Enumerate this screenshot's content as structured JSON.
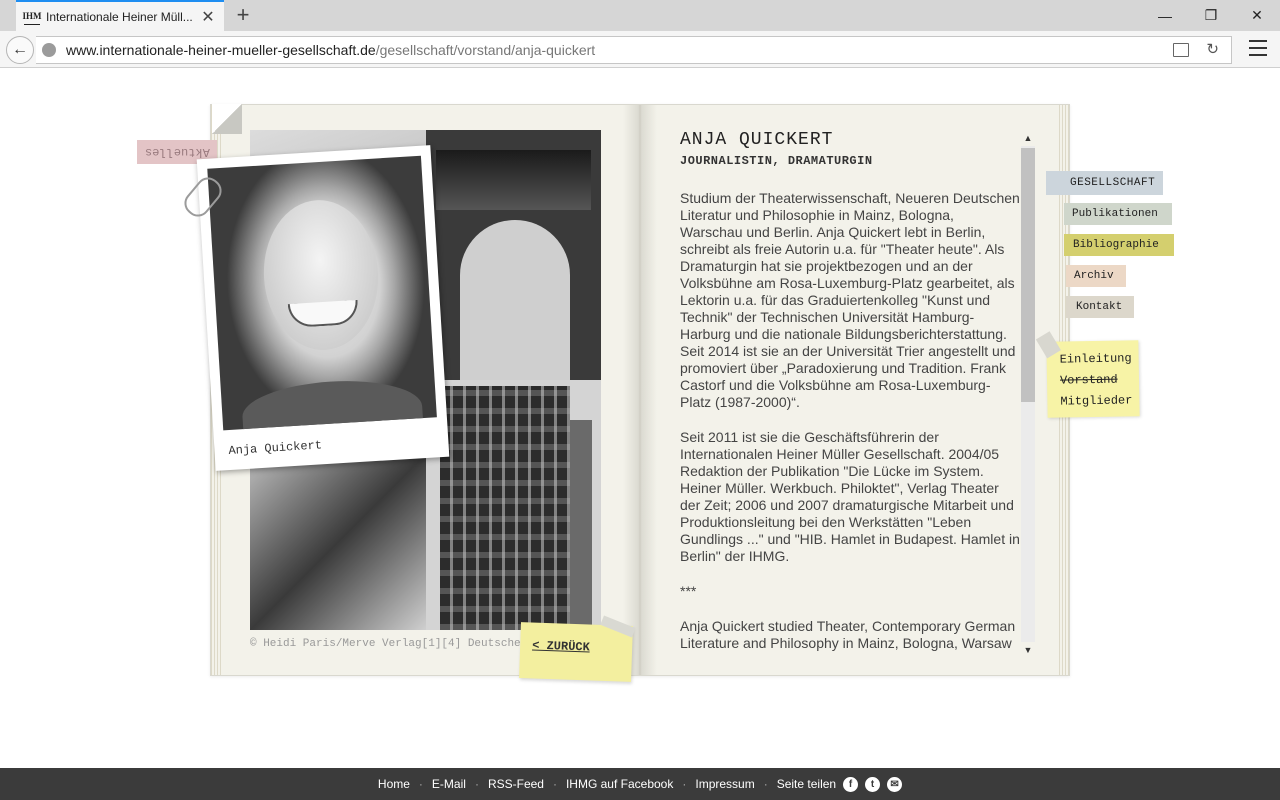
{
  "browser": {
    "tab_title": "Internationale Heiner Müll...",
    "favicon_text": "IHM",
    "url_host": "www.internationale-heiner-mueller-gesellschaft.de",
    "url_path": "/gesellschaft/vorstand/anja-quickert"
  },
  "page": {
    "aktuelles_label": "Aktuelles",
    "polaroid_caption": "Anja Quickert",
    "credit": "© Heidi Paris/Merve Verlag[1][4] Deutscher Bauernverlag (DDR)[2] Margit Broich[3]",
    "back_label": "< ZURÜCK",
    "name": "ANJA QUICKERT",
    "role": "JOURNALISTIN, DRAMATURGIN",
    "paragraphs": [
      "Studium der Theaterwissenschaft, Neueren Deutschen Literatur und Philosophie in Mainz, Bologna, Warschau und Berlin. Anja Quickert lebt in Berlin, schreibt als freie Autorin u.a. für \"Theater heute\". Als Dramaturgin hat sie projektbezogen und an der Volksbühne am Rosa-Luxemburg-Platz gearbeitet, als Lektorin u.a. für das Graduiertenkolleg \"Kunst und Technik\" der Technischen Universität Hamburg-Harburg und die nationale Bildungsberichterstattung. Seit 2014 ist sie an der Universität Trier angestellt und promoviert über „Paradoxierung und Tradition. Frank Castorf und die Volksbühne am Rosa-Luxemburg-Platz (1987-2000)“.",
      "Seit 2011 ist sie die Geschäftsführerin der Internationalen Heiner Müller Gesellschaft. 2004/05 Redaktion der Publikation \"Die Lücke im System. Heiner Müller. Werkbuch. Philoktet\", Verlag Theater der Zeit; 2006 und 2007 dramaturgische Mitarbeit und Produktionsleitung bei den Werkstätten \"Leben Gundlings ...\" und \"HIB. Hamlet in Budapest. Hamlet in Berlin\" der IHMG.",
      "***",
      "Anja Quickert studied Theater, Contemporary German Literature and Philosophy in Mainz, Bologna, Warsaw"
    ]
  },
  "nav": {
    "gesellschaft": "GESELLSCHAFT",
    "publikationen": "Publikationen",
    "bibliographie": "Bibliographie",
    "archiv": "Archiv",
    "kontakt": "Kontakt"
  },
  "subnav": [
    "Einleitung",
    "Vorstand",
    "Mitglieder"
  ],
  "footer": {
    "links": [
      "Home",
      "E-Mail",
      "RSS-Feed",
      "IHMG auf Facebook",
      "Impressum",
      "Seite teilen"
    ]
  }
}
